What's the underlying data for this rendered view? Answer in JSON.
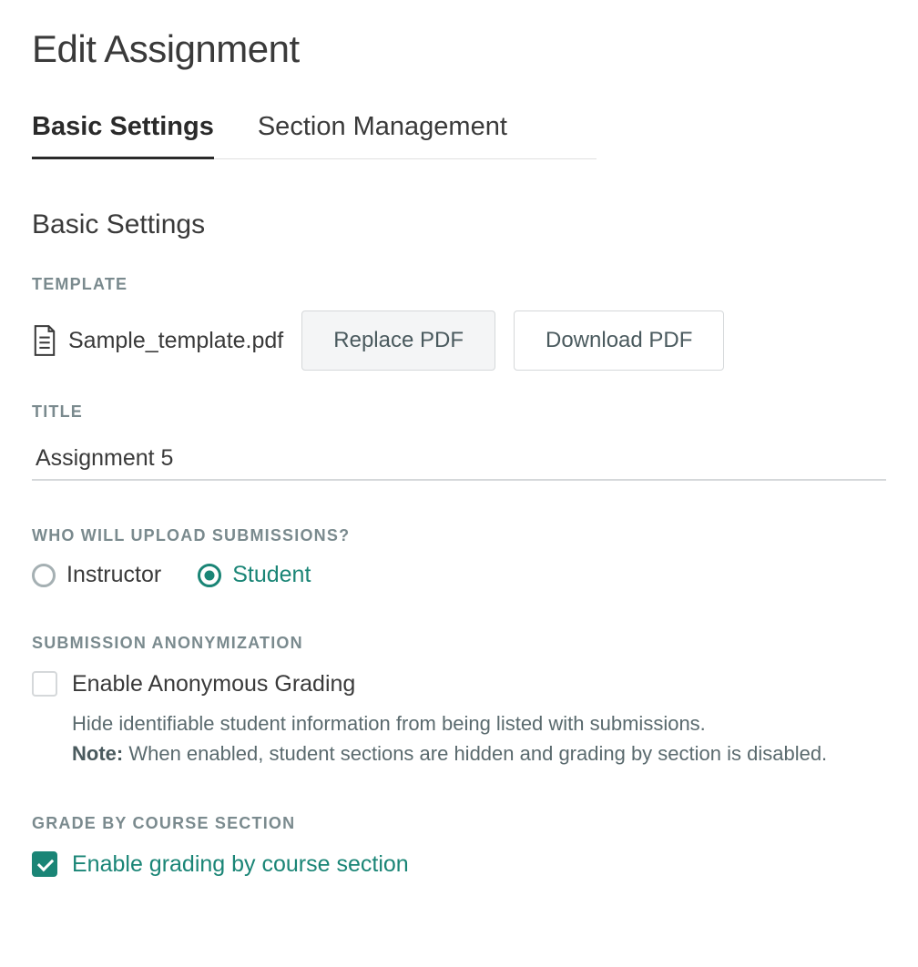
{
  "page": {
    "title": "Edit Assignment"
  },
  "tabs": [
    {
      "label": "Basic Settings",
      "active": true
    },
    {
      "label": "Section Management",
      "active": false
    }
  ],
  "section": {
    "heading": "Basic Settings"
  },
  "template": {
    "label": "TEMPLATE",
    "filename": "Sample_template.pdf",
    "replace_button": "Replace PDF",
    "download_button": "Download PDF"
  },
  "title_field": {
    "label": "TITLE",
    "value": "Assignment 5"
  },
  "uploader": {
    "label": "WHO WILL UPLOAD SUBMISSIONS?",
    "options": [
      {
        "label": "Instructor",
        "selected": false
      },
      {
        "label": "Student",
        "selected": true
      }
    ]
  },
  "anonymization": {
    "label": "SUBMISSION ANONYMIZATION",
    "checkbox_label": "Enable Anonymous Grading",
    "checked": false,
    "description": "Hide identifiable student information from being listed with submissions.",
    "note_prefix": "Note:",
    "note_text": " When enabled, student sections are hidden and grading by section is disabled."
  },
  "grade_by_section": {
    "label": "GRADE BY COURSE SECTION",
    "checkbox_label": "Enable grading by course section",
    "checked": true
  }
}
